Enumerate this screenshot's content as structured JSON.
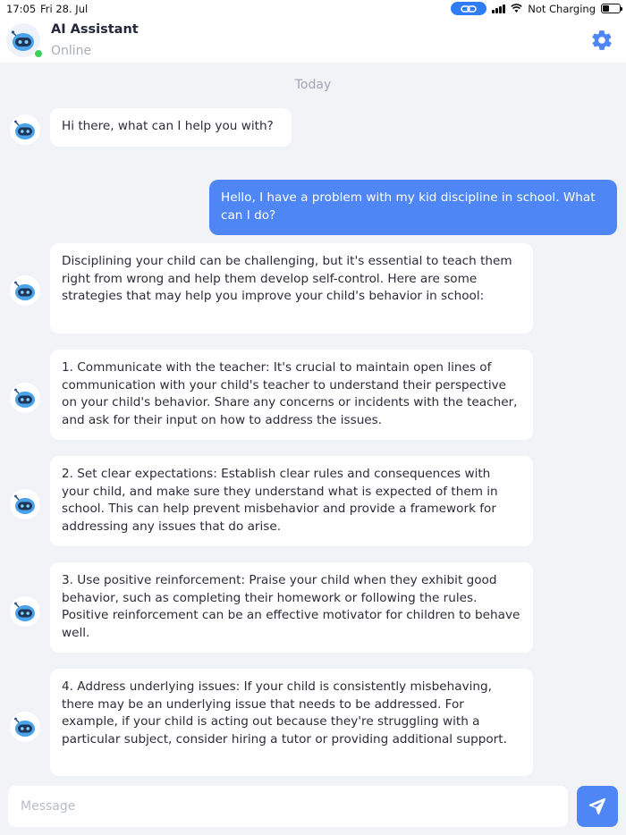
{
  "statusbar": {
    "time": "17:05",
    "date": "Fri 28. Jul",
    "battery_text": "Not Charging"
  },
  "header": {
    "title": "AI Assistant",
    "status": "Online"
  },
  "chat": {
    "day_label": "Today",
    "messages": [
      {
        "role": "bot",
        "text": "Hi there, what can I help you with?"
      },
      {
        "role": "user",
        "text": "Hello, I have a problem with my kid discipline in school. What can I do?"
      },
      {
        "role": "bot",
        "text": "Disciplining your child can be challenging, but it's essential to teach them right from wrong and help them develop self-control. Here are some strategies that may help you improve your child's behavior in school:"
      },
      {
        "role": "bot",
        "text": "1. Communicate with the teacher: It's crucial to maintain open lines of communication with your child's teacher to understand their perspective on your child's behavior. Share any concerns or incidents with the teacher, and ask for their input on how to address the issues."
      },
      {
        "role": "bot",
        "text": "2. Set clear expectations: Establish clear rules and consequences with your child, and make sure they understand what is expected of them in school. This can help prevent misbehavior and provide a framework for addressing any issues that do arise."
      },
      {
        "role": "bot",
        "text": "3. Use positive reinforcement: Praise your child when they exhibit good behavior, such as completing their homework or following the rules. Positive reinforcement can be an effective motivator for children to behave well."
      },
      {
        "role": "bot",
        "text": "4. Address underlying issues: If your child is consistently misbehaving, there may be an underlying issue that needs to be addressed. For example, if your child is acting out because they're struggling with a particular subject, consider hiring a tutor or providing additional support."
      }
    ]
  },
  "composer": {
    "placeholder": "Message"
  },
  "colors": {
    "accent": "#4f86f5",
    "online": "#3ecf5a",
    "background": "#f2f3f7"
  },
  "icons": [
    "robot-avatar-icon",
    "gear-icon",
    "send-icon",
    "link-icon",
    "signal-icon",
    "wifi-icon",
    "battery-icon"
  ]
}
